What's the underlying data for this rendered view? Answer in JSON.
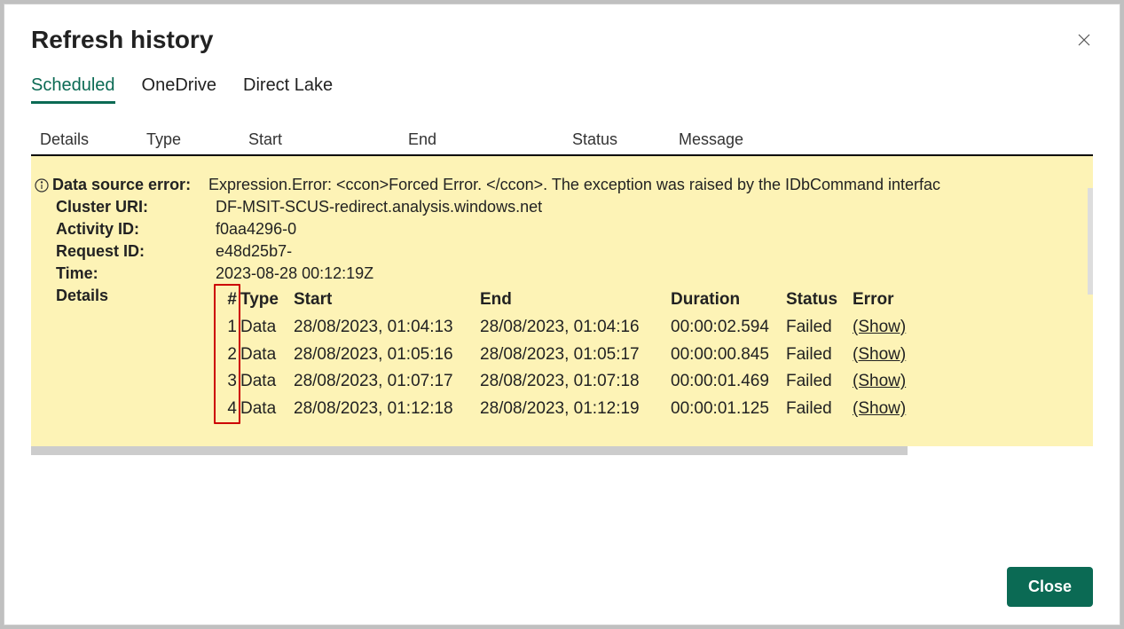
{
  "dialog": {
    "title": "Refresh history",
    "close_label": "Close"
  },
  "tabs": {
    "scheduled": "Scheduled",
    "onedrive": "OneDrive",
    "directlake": "Direct Lake"
  },
  "outer_columns": {
    "details": "Details",
    "type": "Type",
    "start": "Start",
    "end": "End",
    "status": "Status",
    "message": "Message"
  },
  "error": {
    "data_source_label": "Data source error:",
    "data_source_value": "Expression.Error: <ccon>Forced Error. </ccon>. The exception was raised by the IDbCommand interfac",
    "cluster_label": "Cluster URI:",
    "cluster_value": "DF-MSIT-SCUS-redirect.analysis.windows.net",
    "activity_label": "Activity ID:",
    "activity_value": "f0aa4296-0",
    "request_label": "Request ID:",
    "request_value": "e48d25b7-",
    "time_label": "Time:",
    "time_value": "2023-08-28 00:12:19Z",
    "details_label": "Details"
  },
  "details_header": {
    "num": "#",
    "type": "Type",
    "start": "Start",
    "end": "End",
    "duration": "Duration",
    "status": "Status",
    "error": "Error"
  },
  "details_rows": [
    {
      "num": "1",
      "type": "Data",
      "start": "28/08/2023, 01:04:13",
      "end": "28/08/2023, 01:04:16",
      "duration": "00:00:02.594",
      "status": "Failed",
      "error": "(Show)"
    },
    {
      "num": "2",
      "type": "Data",
      "start": "28/08/2023, 01:05:16",
      "end": "28/08/2023, 01:05:17",
      "duration": "00:00:00.845",
      "status": "Failed",
      "error": "(Show)"
    },
    {
      "num": "3",
      "type": "Data",
      "start": "28/08/2023, 01:07:17",
      "end": "28/08/2023, 01:07:18",
      "duration": "00:00:01.469",
      "status": "Failed",
      "error": "(Show)"
    },
    {
      "num": "4",
      "type": "Data",
      "start": "28/08/2023, 01:12:18",
      "end": "28/08/2023, 01:12:19",
      "duration": "00:00:01.125",
      "status": "Failed",
      "error": "(Show)"
    }
  ]
}
